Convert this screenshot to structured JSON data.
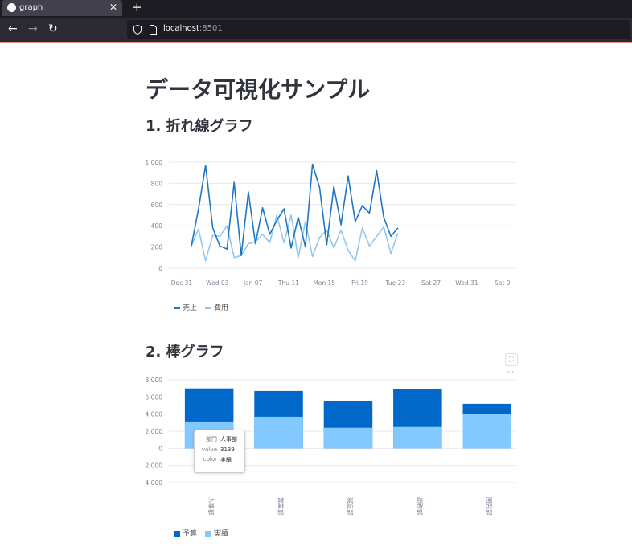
{
  "browser": {
    "tab_title": "graph",
    "tab_close": "✕",
    "new_tab": "+",
    "url_host": "localhost",
    "url_port": ":8501",
    "back": "←",
    "forward": "→",
    "reload": "↻"
  },
  "page": {
    "title": "データ可視化サンプル",
    "section1_title": "1. 折れ線グラフ",
    "section2_title": "2. 棒グラフ"
  },
  "chart_data": [
    {
      "type": "line",
      "x_ticks": [
        "Dec 31",
        "Wed 03",
        "Jan 07",
        "Thu 11",
        "Mon 15",
        "Fri 19",
        "Tue 23",
        "Sat 27",
        "Wed 31",
        "Sat 0"
      ],
      "y_ticks": [
        "0",
        "200",
        "400",
        "600",
        "800",
        "1,000"
      ],
      "ylim": [
        0,
        1000
      ],
      "x_start": "Jan 01",
      "series": [
        {
          "name": "売上",
          "color": "#1f77c4",
          "values": [
            210,
            560,
            970,
            380,
            210,
            180,
            810,
            120,
            720,
            230,
            570,
            320,
            450,
            560,
            190,
            480,
            200,
            980,
            760,
            220,
            770,
            410,
            870,
            440,
            590,
            520,
            920,
            480,
            300,
            380
          ]
        },
        {
          "name": "費用",
          "color": "#90c8f0",
          "values": [
            210,
            370,
            70,
            310,
            300,
            400,
            100,
            120,
            230,
            250,
            320,
            240,
            500,
            240,
            500,
            100,
            440,
            110,
            290,
            360,
            190,
            360,
            170,
            70,
            380,
            210,
            300,
            390,
            140,
            330
          ]
        }
      ],
      "legend_placement": "bottom-left",
      "grid": true
    },
    {
      "type": "bar",
      "stacked": false,
      "categories": [
        "人事部",
        "営業部",
        "製造部",
        "総務部",
        "開発部"
      ],
      "y_ticks": [
        "8,000",
        "6,000",
        "4,000",
        "2,000",
        "0",
        "2,000",
        "4,000"
      ],
      "ylim": [
        -4000,
        8000
      ],
      "series": [
        {
          "name": "予算",
          "color": "#0068c9",
          "values": [
            7000,
            6700,
            5500,
            6900,
            5200
          ]
        },
        {
          "name": "実績",
          "color": "#83c9ff",
          "values": [
            3139,
            3700,
            2400,
            2500,
            4000
          ]
        }
      ],
      "legend_placement": "bottom-left",
      "grid": true,
      "tooltip": {
        "rows": [
          {
            "key": "部門",
            "value": "人事部"
          },
          {
            "key": "value",
            "value": "3139"
          },
          {
            "key": "color",
            "value": "実績"
          }
        ]
      },
      "toolbar": {
        "fullscreen": "⛶",
        "menu": "···"
      }
    }
  ]
}
